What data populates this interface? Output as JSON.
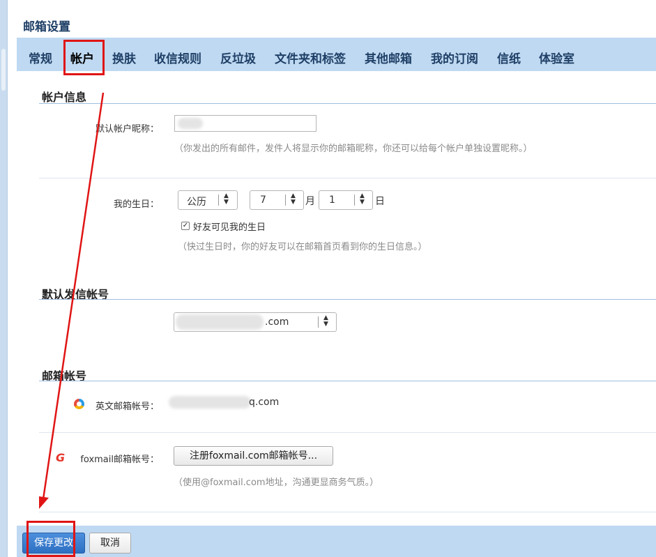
{
  "page": {
    "title": "邮箱设置"
  },
  "tabs": [
    {
      "label": "常规"
    },
    {
      "label": "帐户"
    },
    {
      "label": "换肤"
    },
    {
      "label": "收信规则"
    },
    {
      "label": "反垃圾"
    },
    {
      "label": "文件夹和标签"
    },
    {
      "label": "其他邮箱"
    },
    {
      "label": "我的订阅"
    },
    {
      "label": "信纸"
    },
    {
      "label": "体验室"
    }
  ],
  "active_tab": "帐户",
  "account_info": {
    "section_title": "帐户信息",
    "nickname_label": "默认帐户昵称：",
    "nickname_value": "",
    "nickname_hint": "（你发出的所有邮件，发件人将显示你的邮箱昵称，你还可以给每个帐户单独设置昵称。）",
    "birthday_label": "我的生日：",
    "calendar_value": "公历",
    "month_value": "7",
    "month_unit": "月",
    "day_value": "1",
    "day_unit": "日",
    "friends_visible_label": "好友可见我的生日",
    "friends_visible_checked": true,
    "birthday_hint": "（快过生日时，你的好友可以在邮箱首页看到你的生日信息。）"
  },
  "default_sender": {
    "section_title": "默认发信帐号",
    "selected_suffix": ".com"
  },
  "mail_accounts": {
    "section_title": "邮箱帐号",
    "english_label": "英文邮箱帐号：",
    "english_suffix": "q.com",
    "foxmail_label": "foxmail邮箱帐号：",
    "foxmail_register_button": "注册foxmail.com邮箱帐号...",
    "foxmail_hint": "（使用@foxmail.com地址，沟通更显商务气质。）"
  },
  "footer": {
    "save_label": "保存更改",
    "cancel_label": "取消"
  },
  "colors": {
    "tab_bar_bg": "#bfd9f2",
    "tab_text": "#1f3f66",
    "primary_button": "#3a7fd0",
    "annotation_red": "#e01414"
  }
}
